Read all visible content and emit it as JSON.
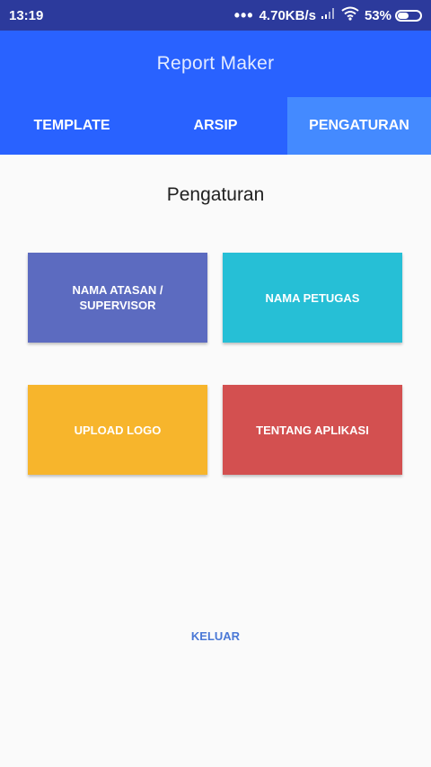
{
  "status_bar": {
    "time": "13:19",
    "dots": "•••",
    "speed": "4.70KB/s",
    "battery_percent": "53%",
    "battery_level": 0.53,
    "signal_icon": "signal-icon",
    "wifi_icon": "wifi-icon",
    "battery_icon": "battery-icon"
  },
  "app_bar": {
    "title": "Report Maker"
  },
  "tabs": [
    {
      "label": "TEMPLATE",
      "active": false
    },
    {
      "label": "ARSIP",
      "active": false
    },
    {
      "label": "PENGATURAN",
      "active": true
    }
  ],
  "page": {
    "title": "Pengaturan"
  },
  "cards": [
    {
      "label": "NAMA ATASAN /\nSUPERVISOR",
      "color": "#5c6bc0"
    },
    {
      "label": "NAMA PETUGAS",
      "color": "#26bfd6"
    },
    {
      "label": "UPLOAD LOGO",
      "color": "#f7b52c"
    },
    {
      "label": "TENTANG APLIKASI",
      "color": "#d35050"
    }
  ],
  "logout": {
    "label": "KELUAR"
  },
  "colors": {
    "status_bar": "#2c3a9c",
    "primary": "#2962ff",
    "tab_active": "#448aff",
    "background": "#fafafa",
    "logout_text": "#4a78d6"
  }
}
